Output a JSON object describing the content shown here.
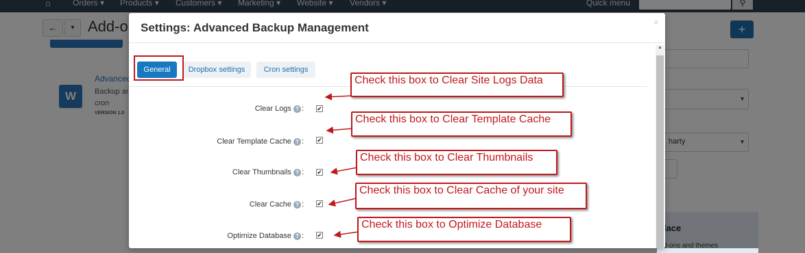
{
  "topnav": {
    "items": [
      "Orders ▾",
      "Products ▾",
      "Customers ▾",
      "Marketing ▾",
      "Website ▾",
      "Vendors ▾"
    ],
    "quick_menu": "Quick menu"
  },
  "page": {
    "title": "Add-on",
    "addon_name": "Advanced",
    "addon_desc": "Backup ar cron",
    "addon_version": "VERSION 1.0",
    "right_field_text": "harty",
    "right_btn_text": "n",
    "marketplace_title": "place",
    "marketplace_text": "add-ons and themes"
  },
  "modal": {
    "title": "Settings: Advanced Backup Management",
    "close_glyph": "×",
    "tabs": [
      {
        "label": "General",
        "active": true
      },
      {
        "label": "Dropbox settings",
        "active": false
      },
      {
        "label": "Cron settings",
        "active": false
      }
    ],
    "settings": [
      {
        "label": "Clear Logs",
        "checked": true
      },
      {
        "label": "Clear Template Cache",
        "checked": true
      },
      {
        "label": "Clear Thumbnails",
        "checked": true
      },
      {
        "label": "Clear Cache",
        "checked": true
      },
      {
        "label": "Optimize Database",
        "checked": true
      }
    ]
  },
  "annotations": [
    "Check this box to Clear Site Logs Data",
    "Check this box to Clear Template Cache",
    "Check this box to Clear Thumbnails",
    "Check this box to Clear Cache of your site",
    "Check this box to Optimize Database"
  ],
  "colors": {
    "annotation_red": "#c0181c",
    "accent_blue": "#1878c0",
    "topnav_bg": "#2f3e4e"
  }
}
